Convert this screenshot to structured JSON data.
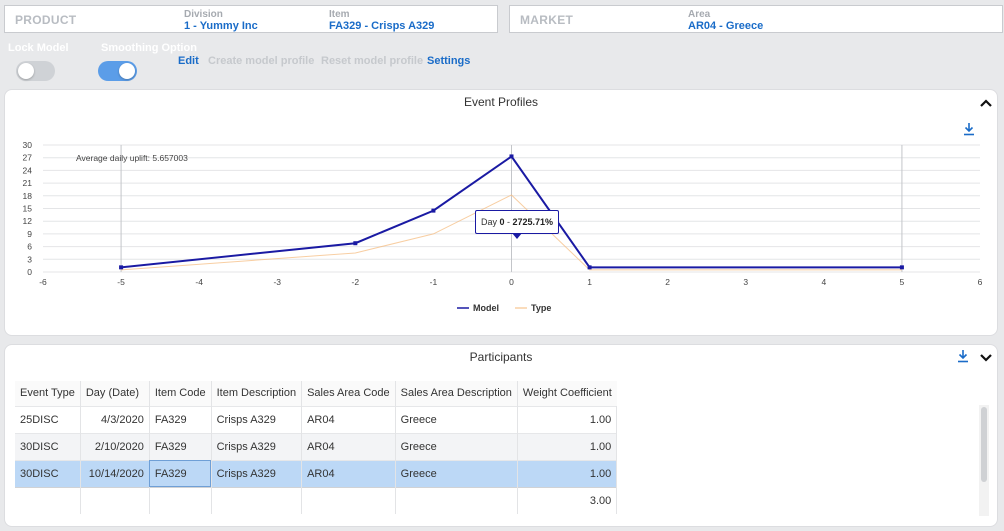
{
  "product": {
    "title": "PRODUCT",
    "division_label": "Division",
    "division_value": "1 - Yummy Inc",
    "item_label": "Item",
    "item_value": "FA329 - Crisps A329"
  },
  "market": {
    "title": "MARKET",
    "area_label": "Area",
    "area_value": "AR04 - Greece"
  },
  "toolbar": {
    "lock_model_label": "Lock Model",
    "lock_model_on": false,
    "smoothing_label": "Smoothing Option",
    "smoothing_on": true,
    "edit_label": "Edit",
    "create_label": "Create model profile",
    "reset_label": "Reset model profile",
    "settings_label": "Settings"
  },
  "colors": {
    "accent": "#1a6cc8",
    "model_series": "#1a1aa3",
    "type_series": "#f5b97a",
    "toggle_on": "#5b9de8",
    "toggle_off": "#cfd2d6",
    "disabled_text": "#c6c9cd"
  },
  "event_profiles": {
    "title": "Event Profiles",
    "annotation": "Average daily uplift: 5.657003",
    "tooltip": {
      "day_prefix": "Day ",
      "day": "0",
      "separator": " - ",
      "value": "2725.71%"
    }
  },
  "chart_data": {
    "type": "line",
    "x_ticks": [
      -6,
      -5,
      -4,
      -3,
      -2,
      -1,
      0,
      1,
      2,
      3,
      4,
      5,
      6
    ],
    "y_ticks": [
      0,
      3,
      6,
      9,
      12,
      15,
      18,
      21,
      24,
      27,
      30
    ],
    "xlim": [
      -6,
      6
    ],
    "ylim": [
      0,
      30
    ],
    "grid": "horizontal",
    "vertical_markers": [
      -5,
      0,
      5
    ],
    "legend_position": "bottom-center",
    "series": [
      {
        "name": "Model",
        "x": [
          -5,
          -2,
          -1,
          0,
          1,
          5
        ],
        "y": [
          1.1,
          6.8,
          14.5,
          27.3,
          1.1,
          1.1
        ],
        "markers": true
      },
      {
        "name": "Type",
        "x": [
          -5,
          -2,
          -1,
          0,
          1,
          5
        ],
        "y": [
          0.5,
          4.5,
          9.0,
          18.2,
          0.5,
          0.5
        ],
        "markers": false
      }
    ]
  },
  "participants": {
    "title": "Participants",
    "columns": [
      "Event Type",
      "Day (Date)",
      "Item Code",
      "Item Description",
      "Sales Area Code",
      "Sales Area Description",
      "Weight Coefficient"
    ],
    "rows": [
      [
        "25DISC",
        "4/3/2020",
        "FA329",
        "Crisps A329",
        "AR04",
        "Greece",
        "1.00"
      ],
      [
        "30DISC",
        "2/10/2020",
        "FA329",
        "Crisps A329",
        "AR04",
        "Greece",
        "1.00"
      ],
      [
        "30DISC",
        "10/14/2020",
        "FA329",
        "Crisps A329",
        "AR04",
        "Greece",
        "1.00"
      ]
    ],
    "total_weight": "3.00"
  },
  "icons": {
    "collapse": "chevron-up-icon",
    "expand": "chevron-down-icon",
    "download": "download-icon"
  }
}
